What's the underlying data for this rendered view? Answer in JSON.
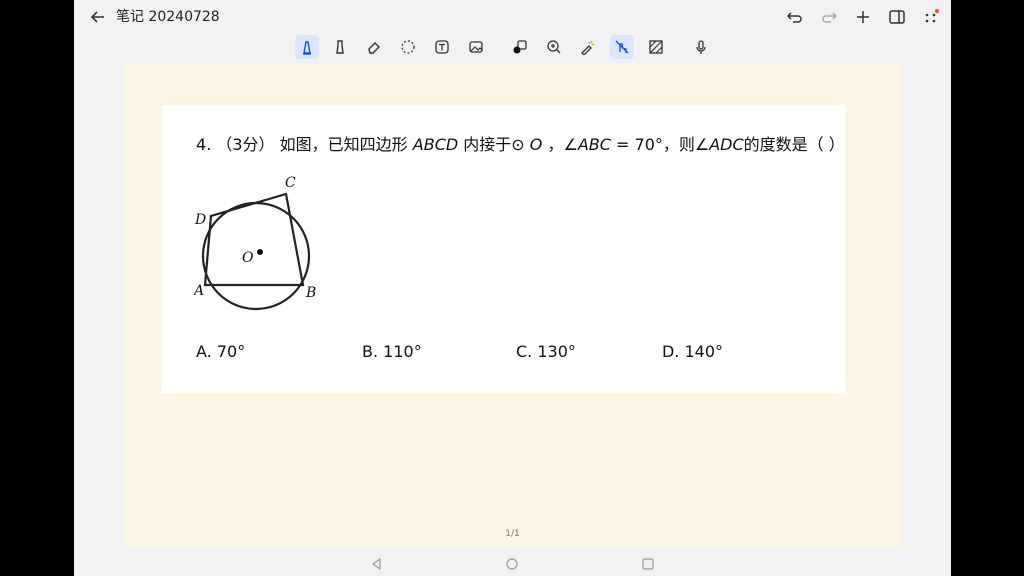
{
  "app": {
    "title": "笔记 20240728"
  },
  "toolbar": {
    "tools": [
      "pen",
      "highlighter",
      "eraser",
      "lasso",
      "text",
      "image",
      "shapes",
      "zoom",
      "laser-pointer",
      "finger-draw",
      "background",
      "voice"
    ],
    "active": [
      "pen",
      "finger-draw"
    ],
    "accent_color": "#dce6ff"
  },
  "question": {
    "number": "4",
    "points": "（3分）",
    "prefix": "如图，已知四边形",
    "quad": "ABCD",
    "mid1": "内接于⊙",
    "circle": "O",
    "mid2": "，∠",
    "angle_given": "ABC",
    "mid3": "= 70°，则∠",
    "angle_asked": "ADC",
    "suffix": "的度数是（     ）"
  },
  "figure": {
    "labels": {
      "A": "A",
      "B": "B",
      "C": "C",
      "D": "D",
      "O": "O"
    }
  },
  "options": [
    {
      "letter": "A.",
      "value": "70°"
    },
    {
      "letter": "B.",
      "value": "110°"
    },
    {
      "letter": "C.",
      "value": "130°"
    },
    {
      "letter": "D.",
      "value": "140°"
    }
  ],
  "page_indicator": "1/1"
}
